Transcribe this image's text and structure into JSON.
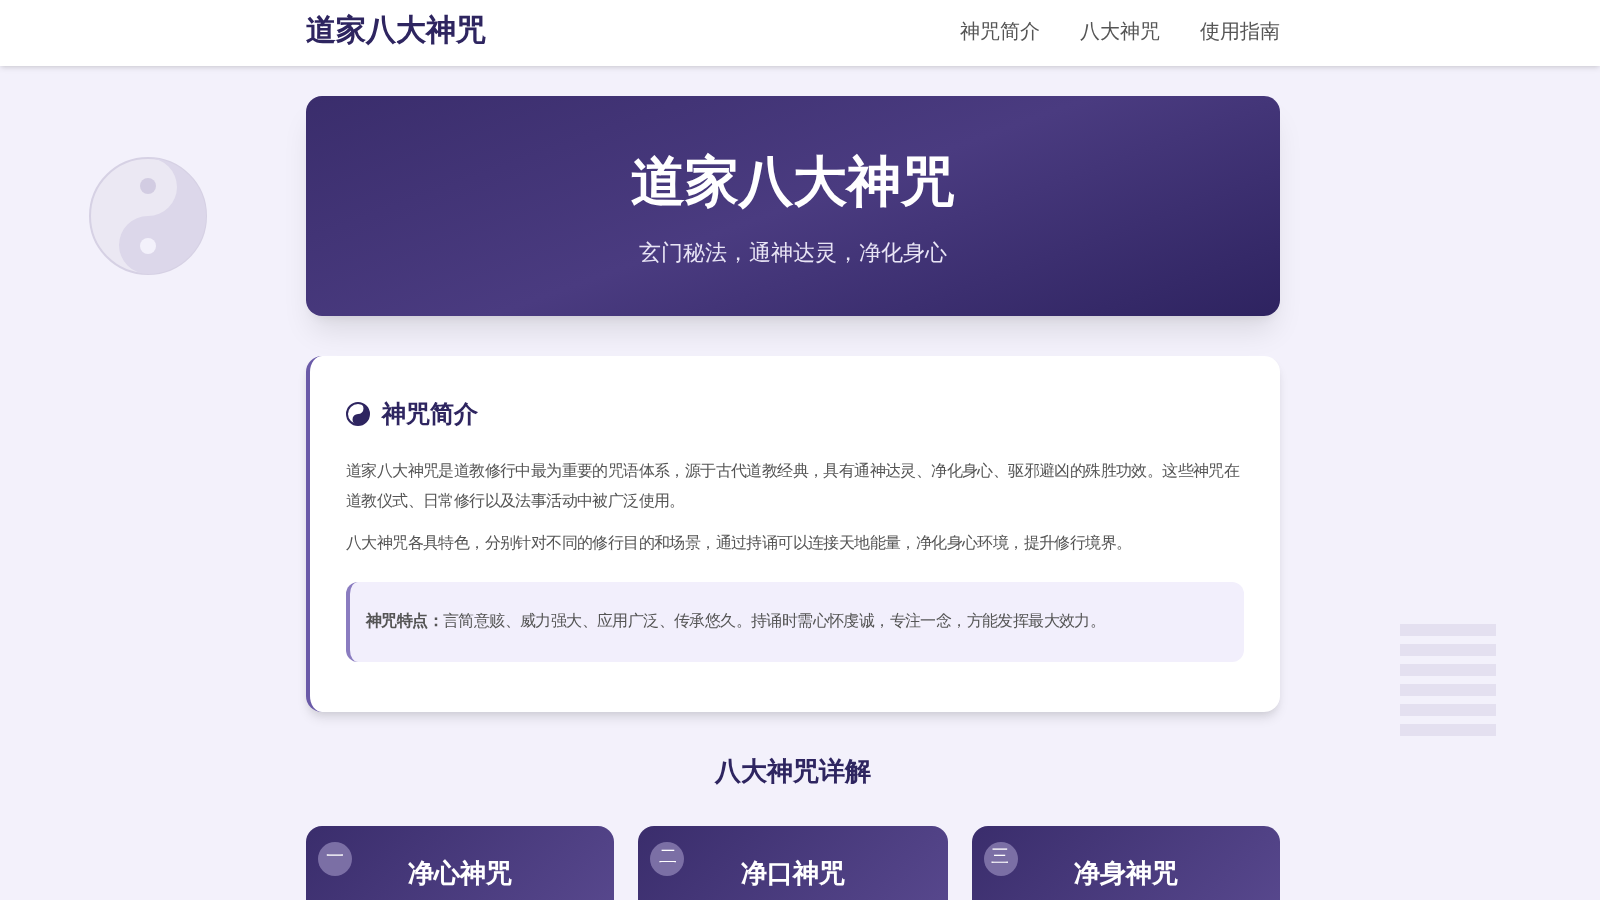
{
  "header": {
    "logo": "道家八大神咒",
    "nav": [
      "神咒简介",
      "八大神咒",
      "使用指南"
    ]
  },
  "hero": {
    "title": "道家八大神咒",
    "subtitle": "玄门秘法，通神达灵，净化身心"
  },
  "intro": {
    "title": "神咒简介",
    "paragraphs": [
      "道家八大神咒是道教修行中最为重要的咒语体系，源于古代道教经典，具有通神达灵、净化身心、驱邪避凶的殊胜功效。这些神咒在道教仪式、日常修行以及法事活动中被广泛使用。",
      "八大神咒各具特色，分别针对不同的修行目的和场景，通过持诵可以连接天地能量，净化身心环境，提升修行境界。"
    ],
    "note": "**神咒特点：**言简意赅、威力强大、应用广泛、传承悠久。持诵时需心怀虔诚，专注一念，方能发挥最大效力。"
  },
  "section": {
    "title": "八大神咒详解"
  },
  "mantras": [
    {
      "number": "一",
      "name": "净心神咒"
    },
    {
      "number": "二",
      "name": "净口神咒"
    },
    {
      "number": "三",
      "name": "净身神咒"
    }
  ]
}
